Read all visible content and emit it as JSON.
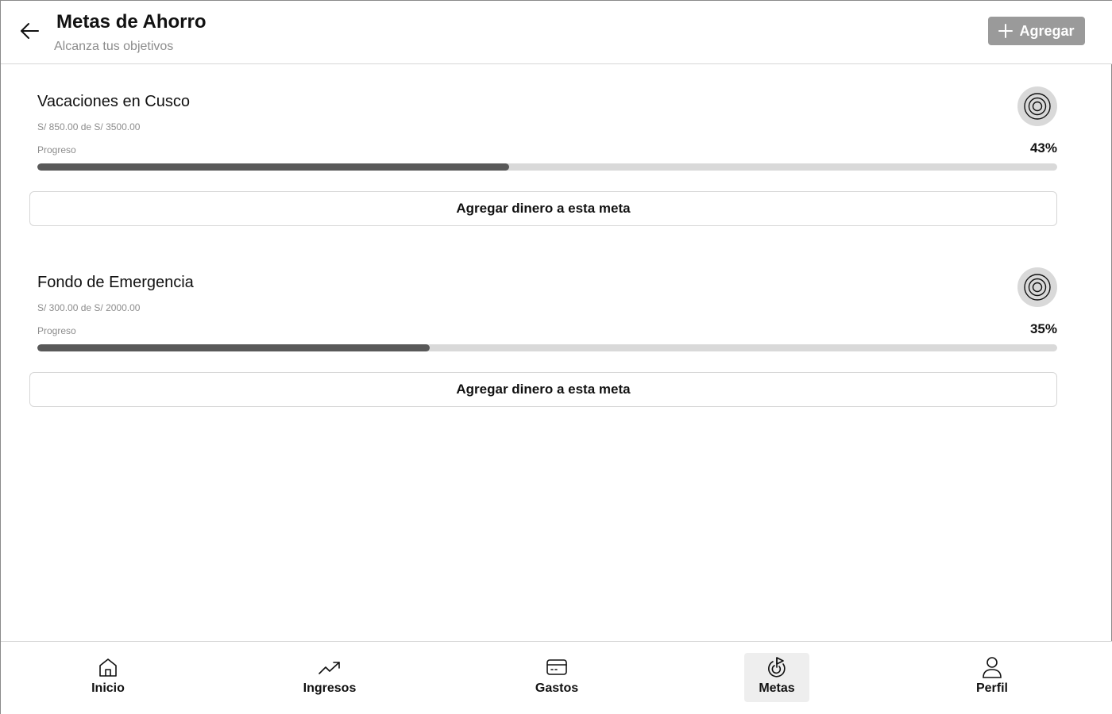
{
  "header": {
    "title": "Metas de Ahorro",
    "subtitle": "Alcanza tus objetivos",
    "add_label": "Agregar",
    "back_icon": "arrow-left-icon",
    "add_icon": "plus-icon"
  },
  "goals": [
    {
      "name": "Vacaciones en Cusco",
      "amount_text": "S/ 850.00 de S/ 3500.00",
      "progress_label": "Progreso",
      "percent_text": "43%",
      "progress_fraction": 0.4623,
      "button_label": "Agregar dinero a esta meta",
      "icon": "target-icon"
    },
    {
      "name": "Fondo de Emergencia",
      "amount_text": "S/ 300.00 de S/ 2000.00",
      "progress_label": "Progreso",
      "percent_text": "35%",
      "progress_fraction": 0.3847,
      "button_label": "Agregar dinero a esta meta",
      "icon": "target-icon"
    }
  ],
  "nav": {
    "items": [
      {
        "label": "Inicio",
        "icon": "home-icon",
        "active": false
      },
      {
        "label": "Ingresos",
        "icon": "trending-up-icon",
        "active": false
      },
      {
        "label": "Gastos",
        "icon": "credit-card-icon",
        "active": false
      },
      {
        "label": "Metas",
        "icon": "goal-target-icon",
        "active": true
      },
      {
        "label": "Perfil",
        "icon": "user-icon",
        "active": false
      }
    ]
  },
  "colors": {
    "progress_fill": "#595959",
    "progress_track": "#d9d9d9",
    "add_button_bg": "#9a9a9a"
  }
}
